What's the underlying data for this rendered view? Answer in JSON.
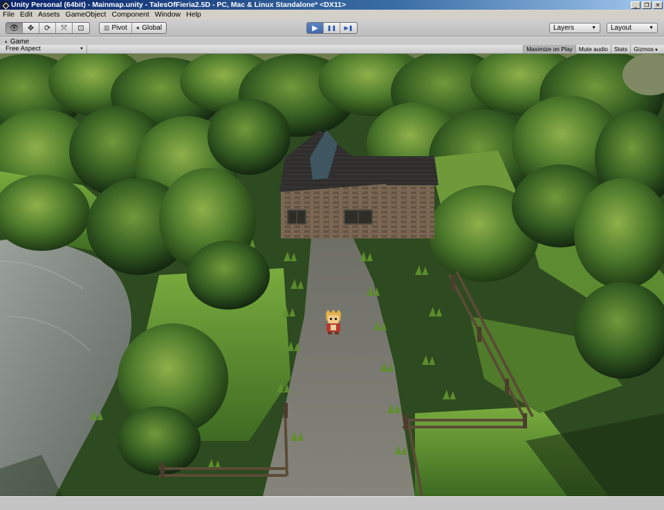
{
  "window": {
    "title": "Unity Personal (64bit) - Mainmap.unity - TalesOfFieria2.5D - PC, Mac & Linux Standalone* <DX11>",
    "minimize_glyph": "_",
    "restore_glyph": "❐",
    "close_glyph": "✕"
  },
  "menu": {
    "items": [
      "File",
      "Edit",
      "Assets",
      "GameObject",
      "Component",
      "Window",
      "Help"
    ]
  },
  "toolbar": {
    "transform_tools": [
      {
        "icon": "eye-icon",
        "glyph": "👁",
        "active": true
      },
      {
        "icon": "move-icon",
        "glyph": "✥",
        "active": false
      },
      {
        "icon": "rotate-icon",
        "glyph": "⟳",
        "active": false
      },
      {
        "icon": "scale-icon",
        "glyph": "⤧",
        "active": false
      },
      {
        "icon": "rect-icon",
        "glyph": "⊡",
        "active": false
      }
    ],
    "pivot_label": "Pivot",
    "global_label": "Global",
    "play": {
      "play_glyph": "▶",
      "pause_glyph": "❚❚",
      "step_glyph": "▶❚",
      "playing": true
    },
    "layers_label": "Layers",
    "layout_label": "Layout"
  },
  "game_view": {
    "tab_label": "Game",
    "aspect_label": "Free Aspect",
    "toggles": {
      "maximize": "Maximize on Play",
      "mute": "Mute audio",
      "stats": "Stats",
      "gizmos": "Gizmos"
    }
  },
  "colors": {
    "title_bar": "#0a246a",
    "play_active": "#3f69ac",
    "foliage": "#3f6a28",
    "water": "#8a8f8a",
    "path": "#77776e",
    "house_wall": "#7e6a55",
    "roof": "#2f2e2d"
  }
}
